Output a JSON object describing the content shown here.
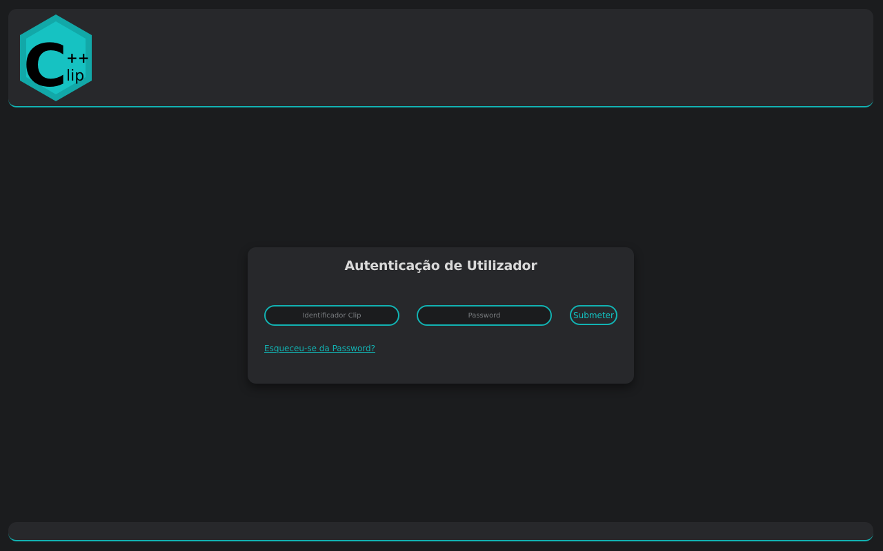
{
  "header": {
    "logo": {
      "icon": "cpp-clip-logo",
      "letter": "C",
      "superscript": "++",
      "subscript": "lip",
      "colors": {
        "outer": "#12b3b3",
        "inner": "#16c7c7",
        "text": "#000000"
      }
    }
  },
  "login": {
    "title": "Autenticação de Utilizador",
    "id_placeholder": "Identificador Clip",
    "password_placeholder": "Password",
    "submit_label": "Submeter",
    "forgot_label": "Esqueceu-se da Password?"
  },
  "theme": {
    "accent": "#12b3b3",
    "background": "#1b1c1e",
    "panel": "#27282b"
  }
}
